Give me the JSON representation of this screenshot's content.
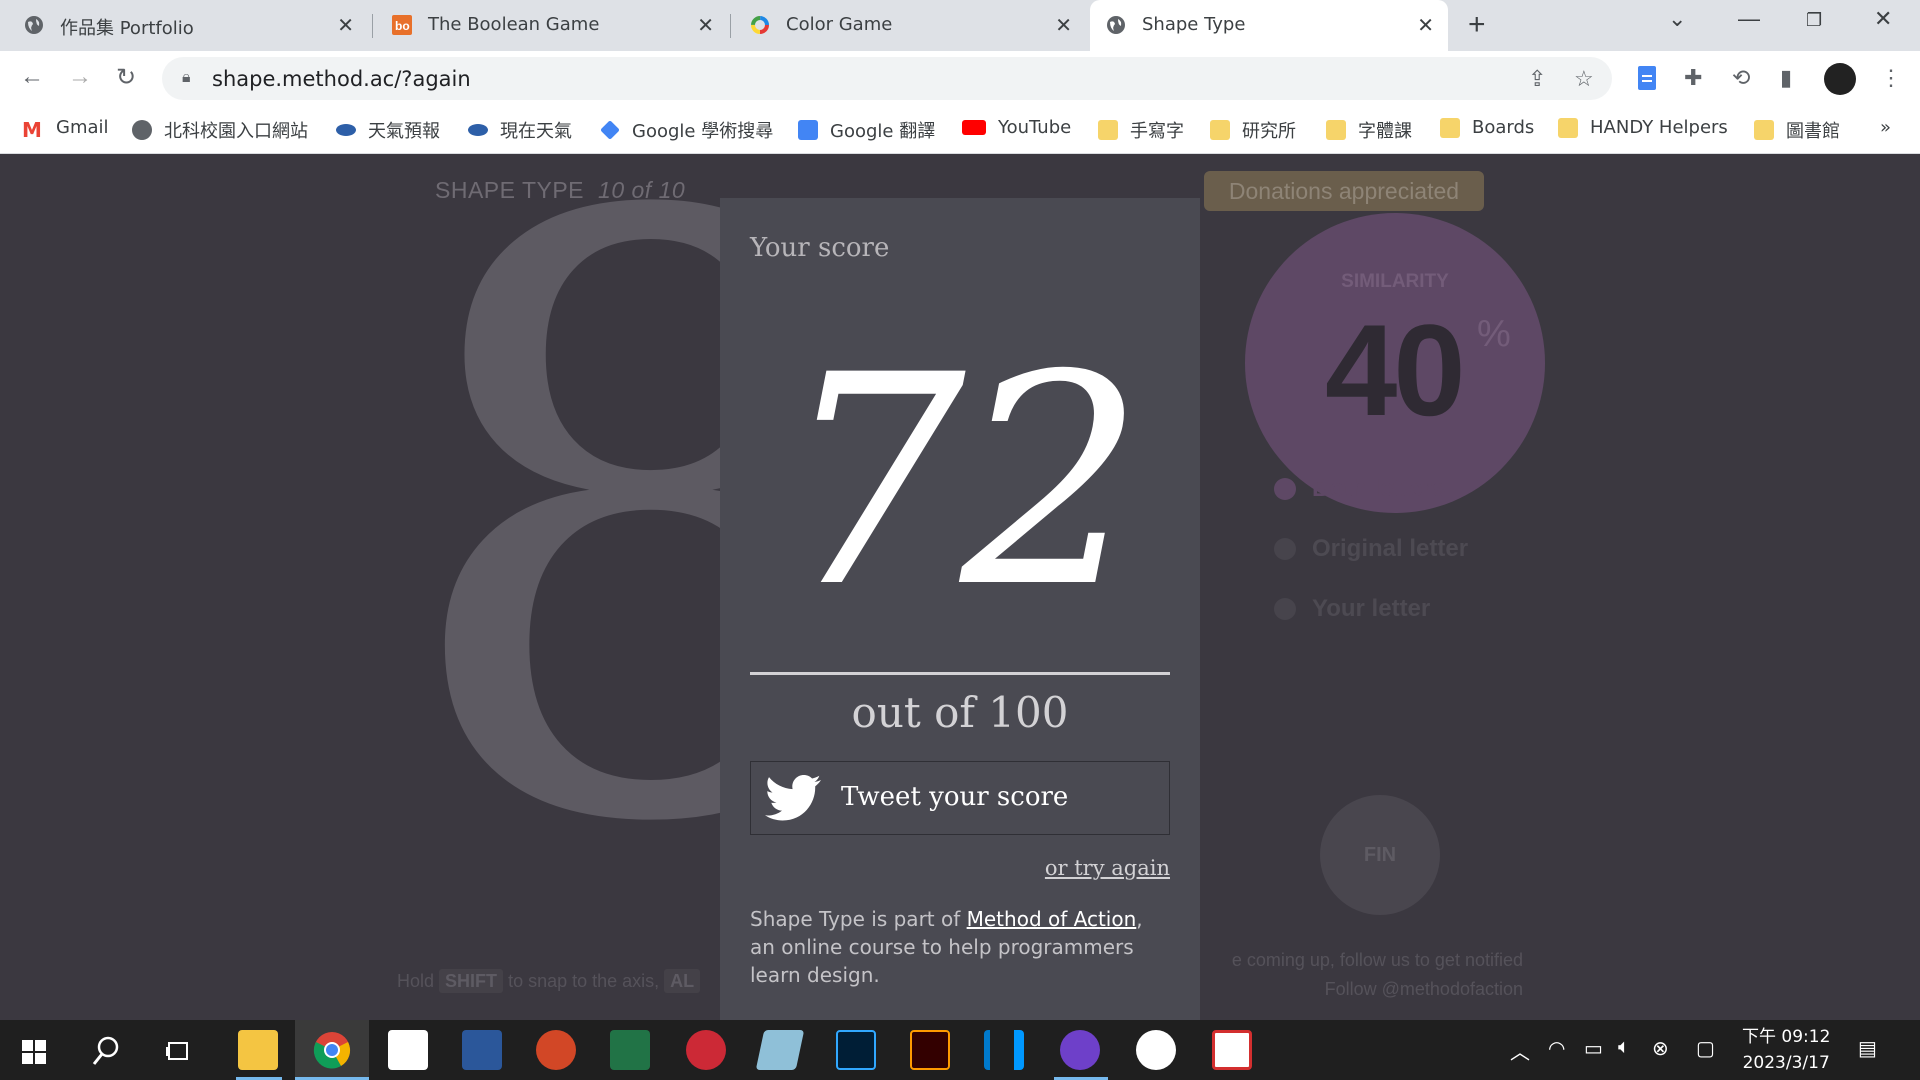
{
  "browser": {
    "tabs": [
      {
        "title": "作品集 Portfolio",
        "icon": "globe-icon"
      },
      {
        "title": "The Boolean Game",
        "icon": "bo-icon"
      },
      {
        "title": "Color Game",
        "icon": "color-ring-icon"
      },
      {
        "title": "Shape Type",
        "icon": "globe-icon"
      }
    ],
    "url": "shape.method.ac/?again",
    "bookmarks": [
      "Gmail",
      "北科校園入口網站",
      "天氣預報",
      "現在天氣",
      "Google 學術搜尋",
      "Google 翻譯",
      "YouTube",
      "手寫字",
      "研究所",
      "字體課",
      "Boards",
      "HANDY Helpers",
      "圖書館"
    ],
    "more_bookmarks": "»"
  },
  "game": {
    "title": "SHAPE TYPE",
    "progress_num": "10",
    "progress_of": "of",
    "progress_total": "10",
    "donate": "Donations appreciated",
    "glyph": "8",
    "similarity_label": "SIMILARITY",
    "similarity_value": "40",
    "similarity_unit": "%",
    "options": [
      "Both letters",
      "Original letter",
      "Your letter"
    ],
    "selected_option": "Both letters",
    "fin": "FIN",
    "hint_hold": "Hold",
    "hint_key1": "SHIFT",
    "hint_mid": "to snap to the axis,",
    "hint_key2": "AL",
    "follow_line1": "e coming up, follow us to get notified",
    "follow_line2": "Follow @methodofaction"
  },
  "modal": {
    "heading": "Your score",
    "score": "72",
    "out_of": "out of 100",
    "tweet": "Tweet your score",
    "try_again": "or try again",
    "about_pre": "Shape Type is part of ",
    "about_link": "Method of Action",
    "about_post": ", an online course to help programmers learn design."
  },
  "taskbar": {
    "apps": [
      "windows-start-icon",
      "search-icon",
      "task-view-icon",
      "file-explorer-icon",
      "chrome-icon",
      "paint-icon",
      "word-icon",
      "powerpoint-icon",
      "excel-icon",
      "zotero-icon",
      "notes-icon",
      "photoshop-icon",
      "illustrator-icon",
      "vscode-icon",
      "github-icon",
      "fontforge-icon",
      "app-icon"
    ],
    "clock_line1": "下午 09:12",
    "clock_line2": "2023/3/17"
  },
  "colors": {
    "page_bg": "#3b3840",
    "modal_bg": "#4a4a52",
    "similarity": "#5e4865",
    "donate_bg": "#6a5e4c"
  }
}
